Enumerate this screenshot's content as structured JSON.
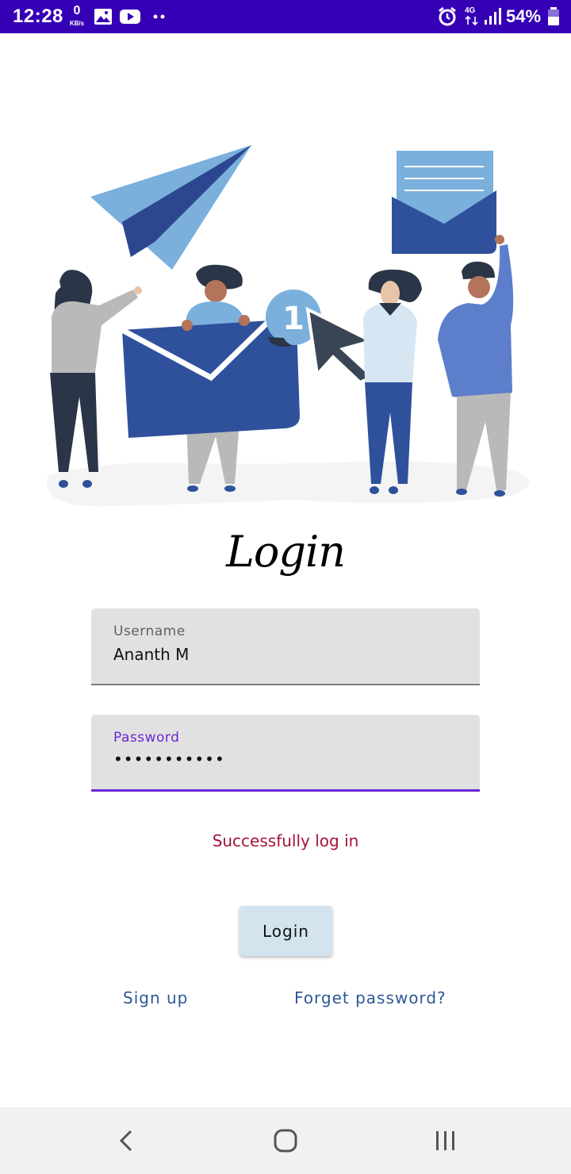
{
  "status_bar": {
    "time": "12:28",
    "net_speed": "0",
    "net_speed_unit": "KB/s",
    "network_type": "4G",
    "battery": "54%",
    "icons": [
      "gallery-icon",
      "youtube-icon",
      "more-dots-icon",
      "alarm-icon",
      "signal-icon",
      "battery-icon"
    ]
  },
  "illustration": {
    "badge_count": "1"
  },
  "title": "Login",
  "username": {
    "label": "Username",
    "value": "Ananth M"
  },
  "password": {
    "label": "Password",
    "value": "•••••••••••"
  },
  "status_message": "Successfully log in",
  "login_button": "Login",
  "links": {
    "signup": "Sign up",
    "forget": "Forget password?"
  },
  "nav": {
    "icons": [
      "back-icon",
      "home-icon",
      "recents-icon"
    ]
  },
  "colors": {
    "status_bar": "#3500b5",
    "accent": "#6a27d6",
    "success_text": "#a31338",
    "link": "#2d5796",
    "button": "#d3e4ef"
  }
}
